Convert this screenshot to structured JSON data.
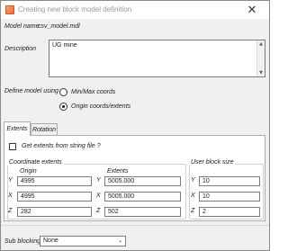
{
  "window": {
    "title": "Creating new block model definition",
    "close_glyph": "✕"
  },
  "form": {
    "model_name_label": "Model name",
    "model_name_value": "csv_model.mdl",
    "description_label": "Description",
    "description_value": "UG mine",
    "define_model_label": "Define model using",
    "define_options": [
      {
        "label": "Min/Max coords",
        "checked": false
      },
      {
        "label": "Origin coords/extents",
        "checked": true
      }
    ]
  },
  "tabs": [
    {
      "label": "Extents",
      "active": true
    },
    {
      "label": "Rotation",
      "active": false
    }
  ],
  "extents": {
    "string_file_label": "Get extents from string file ?",
    "string_file_checked": false,
    "coordinate_extents_label": "Coordinate extents",
    "origin_label": "Origin",
    "extents_label": "Extents",
    "user_block_size_label": "User block size",
    "rows": [
      {
        "axis": "Y",
        "origin": "4995",
        "extents_axis": "Y",
        "extents": "5005.000",
        "block_axis": "Y",
        "block": "10"
      },
      {
        "axis": "X",
        "origin": "4995",
        "extents_axis": "X",
        "extents": "5005.000",
        "block_axis": "X",
        "block": "10"
      },
      {
        "axis": "Z",
        "origin": "282",
        "extents_axis": "Z",
        "extents": "502",
        "block_axis": "Z",
        "block": "2"
      }
    ]
  },
  "sub_blocking": {
    "label": "Sub blocking",
    "value": "None",
    "chevron": "⌄"
  },
  "icons": {
    "scroll_up": "▲",
    "scroll_down": "▼"
  }
}
